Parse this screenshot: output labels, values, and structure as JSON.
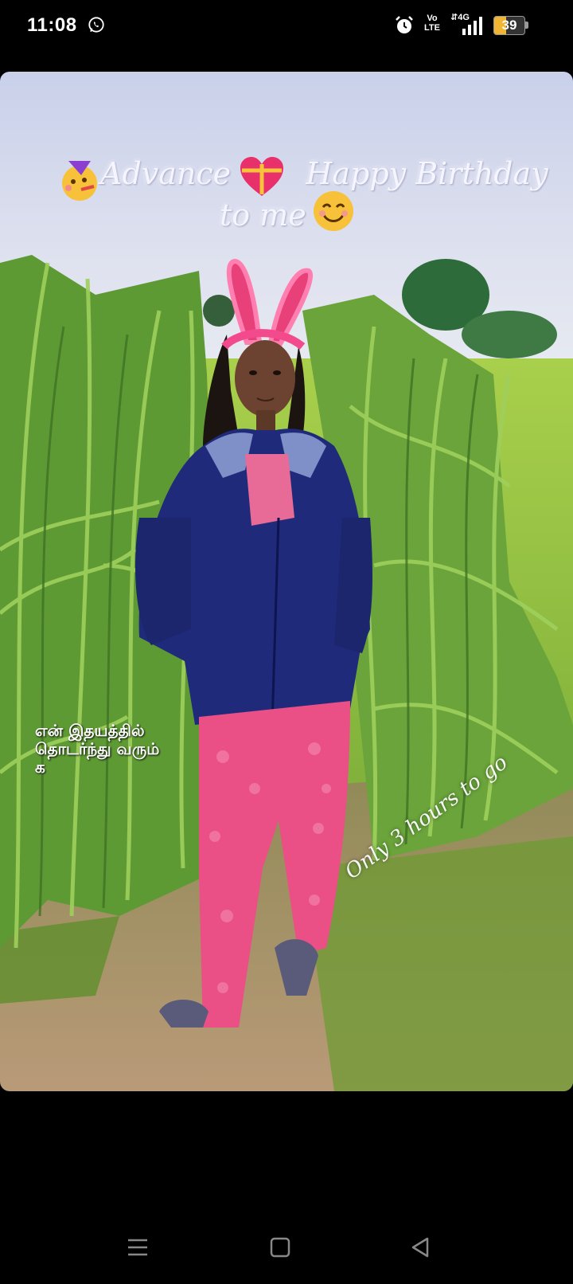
{
  "status_bar": {
    "time": "11:08",
    "notification_icon": "whatsapp-icon",
    "alarm_icon": "alarm-icon",
    "volte_label_top": "Vo",
    "volte_label_bottom": "LTE",
    "network_label": "4G",
    "signal_icon": "signal-bars-icon",
    "battery_level": "39",
    "battery_color": "#f2b533"
  },
  "story": {
    "caption_line1_word1": "Advance",
    "caption_line1_word2": "Happy Birthday",
    "caption_line2": "to me",
    "caption_emojis": [
      "party-face-emoji",
      "heart-gift-emoji",
      "smiling-face-emoji"
    ],
    "tamil_text_line1": "என் இதயத்தில்",
    "tamil_text_line2": "தொடர்ந்து வரும்",
    "tamil_text_line3": "க",
    "countdown_text": "Only 3 hours to go"
  },
  "nav_bar": {
    "menu_icon": "menu-icon",
    "home_icon": "home-square-icon",
    "back_icon": "back-triangle-icon"
  }
}
